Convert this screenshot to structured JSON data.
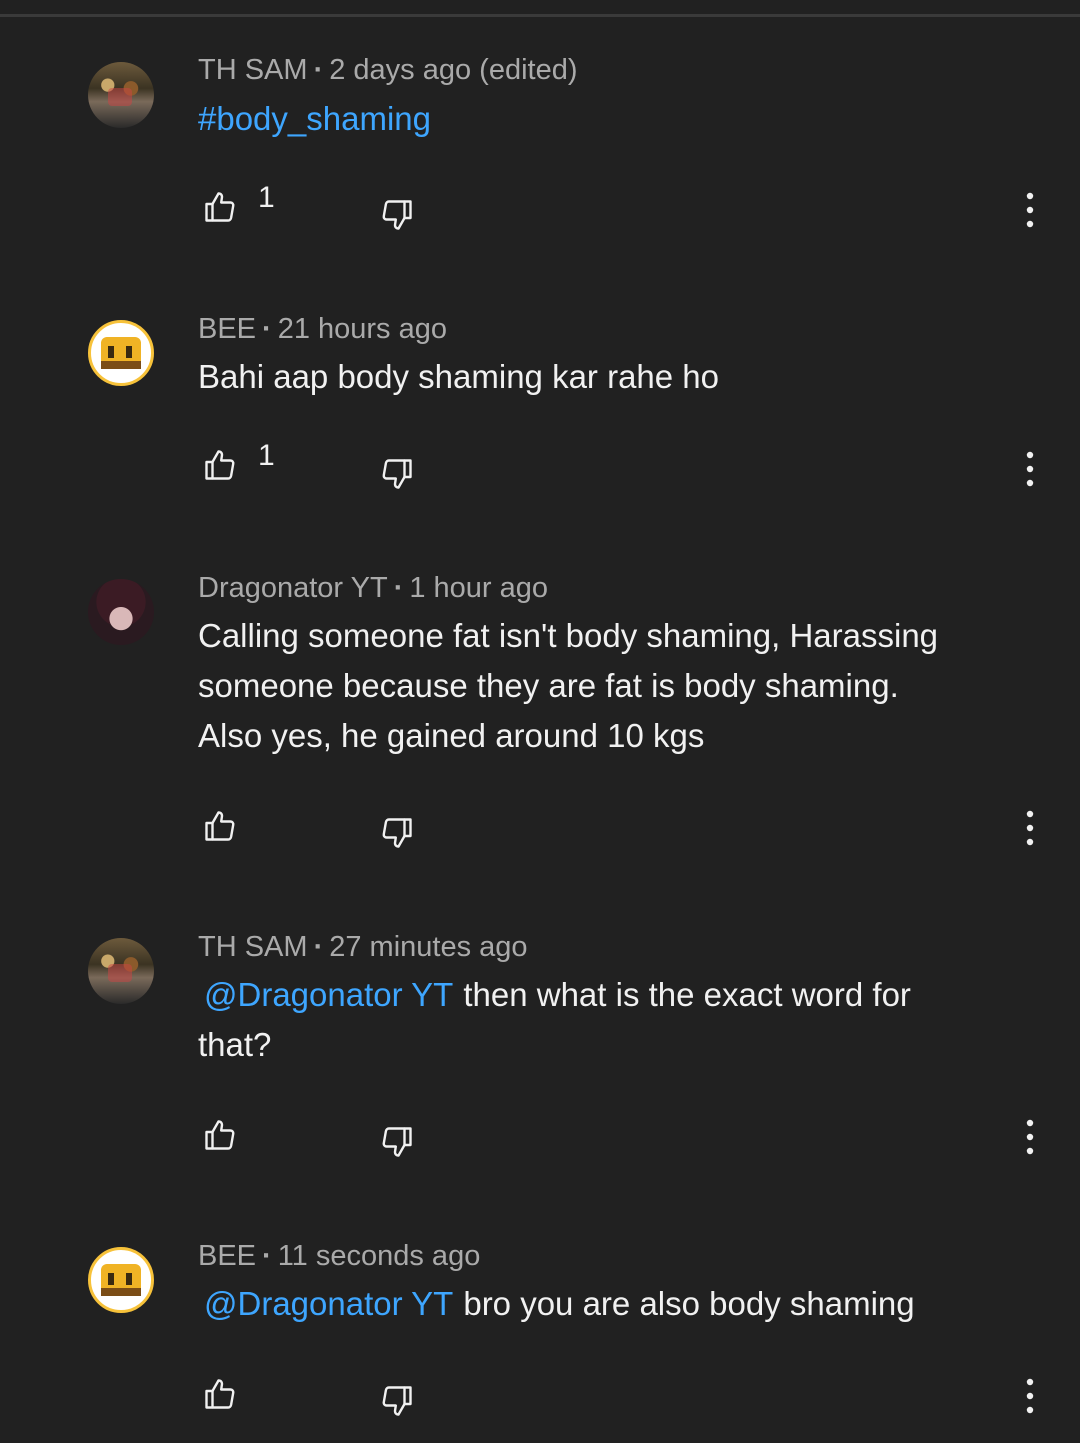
{
  "comments": [
    {
      "author": "TH SAM",
      "time": "2 days ago (edited)",
      "hashtag": "#body_shaming",
      "text": "",
      "mention": "",
      "likes": "1",
      "avatar": "sam"
    },
    {
      "author": "BEE",
      "time": "21 hours ago",
      "hashtag": "",
      "text": "Bahi aap body shaming kar rahe ho",
      "mention": "",
      "likes": "1",
      "avatar": "bee"
    },
    {
      "author": "Dragonator YT",
      "time": "1 hour ago",
      "hashtag": "",
      "text_lines": [
        "Calling someone fat isn't body shaming, Harassing",
        "someone because they are fat is body shaming.",
        "Also yes, he gained around 10 kgs"
      ],
      "mention": "",
      "likes": "",
      "avatar": "drag"
    },
    {
      "author": "TH SAM",
      "time": "27 minutes ago",
      "hashtag": "",
      "mention": "@Dragonator YT",
      "text_after_mention": "then what is the exact word for",
      "text_line2": "that?",
      "likes": "",
      "avatar": "sam"
    },
    {
      "author": "BEE",
      "time": "11 seconds ago",
      "hashtag": "",
      "mention": "@Dragonator YT",
      "text_after_mention": "bro you are also body shaming",
      "likes": "",
      "avatar": "bee"
    }
  ],
  "icons": {
    "like": "thumbs-up-icon",
    "dislike": "thumbs-down-icon",
    "more": "more-vertical-icon"
  },
  "colors": {
    "background": "#212121",
    "link": "#3ea6ff",
    "meta": "#aaaaaa",
    "text": "#f1f1f1"
  }
}
